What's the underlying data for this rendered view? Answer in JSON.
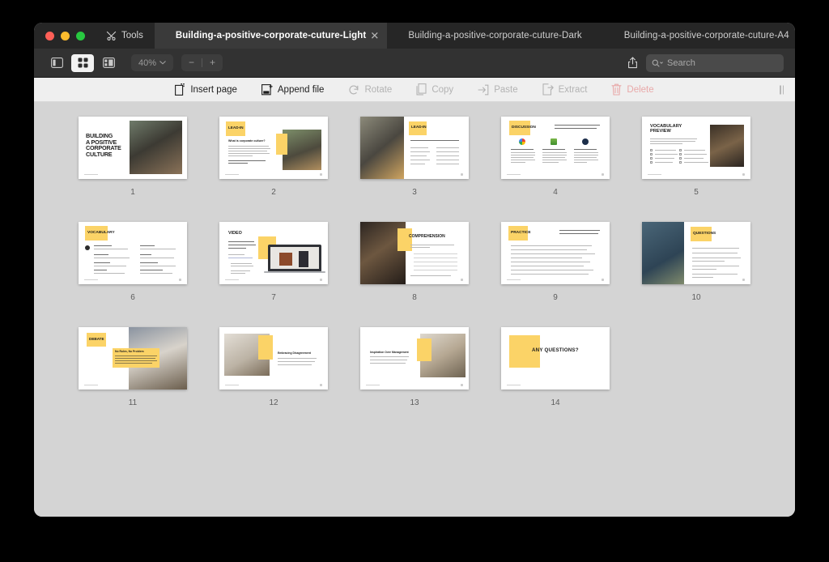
{
  "window": {
    "traffic_lights": [
      "close",
      "minimize",
      "maximize"
    ],
    "tools_label": "Tools",
    "tabs": [
      {
        "label": "Building-a-positive-corporate-cuture-Light",
        "active": true,
        "closable": true
      },
      {
        "label": "Building-a-positive-corporate-cuture-Dark",
        "active": false,
        "closable": false
      },
      {
        "label": "Building-a-positive-corporate-cuture-A4",
        "active": false,
        "closable": false
      }
    ],
    "new_tab_label": "+"
  },
  "toolbar": {
    "sidebar_icon": "sidebar-toggle-icon",
    "grid_icon": "grid-view-icon",
    "split_icon": "split-view-icon",
    "zoom_level": "40%",
    "zoom_chevron": "chevron-down-icon",
    "zoom_out": "−",
    "zoom_in": "+",
    "share_icon": "share-icon",
    "search_icon": "search-icon",
    "search_placeholder": "Search",
    "search_value": ""
  },
  "edit_toolbar": {
    "items": [
      {
        "label": "Insert page",
        "icon": "insert-page-icon",
        "enabled": true
      },
      {
        "label": "Append file",
        "icon": "append-file-icon",
        "enabled": true
      },
      {
        "label": "Rotate",
        "icon": "rotate-icon",
        "enabled": false
      },
      {
        "label": "Copy",
        "icon": "copy-icon",
        "enabled": false
      },
      {
        "label": "Paste",
        "icon": "paste-icon",
        "enabled": false
      },
      {
        "label": "Extract",
        "icon": "extract-icon",
        "enabled": false
      },
      {
        "label": "Delete",
        "icon": "trash-icon",
        "enabled": false
      }
    ],
    "grip_icon": "drag-grip-icon"
  },
  "document": {
    "accent_color": "#fbd367",
    "page_count": 14,
    "pages": [
      {
        "number": "1",
        "title": "BUILDING A POSITIVE CORPORATE CULTURE",
        "layout": "title-photo-right"
      },
      {
        "number": "2",
        "title": "LEAD-IN",
        "subtitle": "What is corporate culture?",
        "layout": "heading-text-photo-right"
      },
      {
        "number": "3",
        "title": "LEAD-IN",
        "subtitle": "Nombres characteristics of a positive corporate culture",
        "layout": "photo-left-two-col-list"
      },
      {
        "number": "4",
        "title": "DISCUSSION",
        "subtitle": "Explore these innovative corporate culture methods used by famous companies and share your thoughts",
        "layout": "three-logo-columns"
      },
      {
        "number": "5",
        "title": "VOCABULARY PREVIEW",
        "subtitle": "Tick a circle if the item next to the words you're familiar with. Then, observe the collocation words on the next page.",
        "layout": "checklist-photo-right"
      },
      {
        "number": "6",
        "title": "VOCABULARY",
        "layout": "two-col-glossary"
      },
      {
        "number": "7",
        "title": "VIDEO",
        "subtitle": "Reed Hasting's Top 5 Lessons Learned Being CEO of Netflix",
        "layout": "video-laptop-right"
      },
      {
        "number": "8",
        "title": "COMPREHENSION",
        "subtitle": "What lessons did Reed Hasting learn while being CEO of Netflix?",
        "layout": "photo-left-numbered-lines"
      },
      {
        "number": "9",
        "title": "PRACTICE",
        "subtitle": "You have the first part of a sentence. Make it longer and more detailed by using the suggested keywords.",
        "layout": "numbered-exercise-lines"
      },
      {
        "number": "10",
        "title": "QUESTIONS",
        "layout": "photo-left-numbered-questions"
      },
      {
        "number": "11",
        "title": "DEBATE",
        "callout_title": "No Rules, No Problem",
        "callout_body": "Companies should adopt a 'no rules' approach to policies like vacation and expenses to empower employees and stimulate innovation.",
        "layout": "debate-callout-photo"
      },
      {
        "number": "12",
        "title": "Embracing Disagreement",
        "body": "Encouraging open disagreement within a company leads to better decision-making and prevents costly mistakes.",
        "layout": "photo-left-text-right"
      },
      {
        "number": "13",
        "title": "Inspiration Over Management",
        "body": "Leaders should focus on inspiring their teams rather than managing them, as this fosters creativity and drives high performance.",
        "layout": "text-left-photo-right"
      },
      {
        "number": "14",
        "title": "ANY QUESTIONS?",
        "layout": "closing"
      }
    ]
  }
}
